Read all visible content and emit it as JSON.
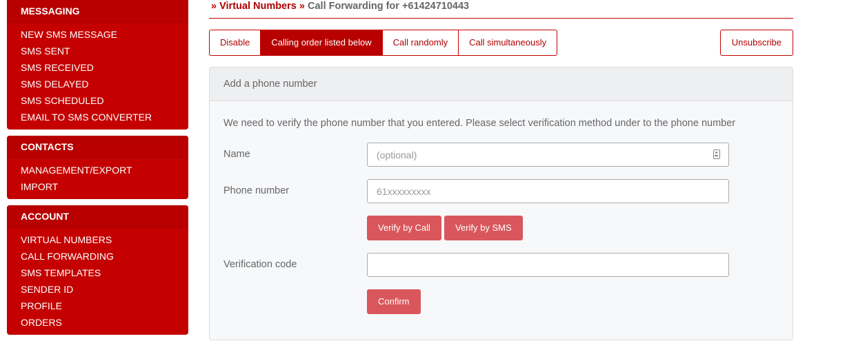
{
  "sidebar": {
    "messaging": {
      "title": "MESSAGING",
      "items": [
        "NEW SMS MESSAGE",
        "SMS SENT",
        "SMS RECEIVED",
        "SMS DELAYED",
        "SMS SCHEDULED",
        "EMAIL TO SMS CONVERTER"
      ]
    },
    "contacts": {
      "title": "CONTACTS",
      "items": [
        "MANAGEMENT/EXPORT",
        "IMPORT"
      ]
    },
    "account": {
      "title": "ACCOUNT",
      "items": [
        "VIRTUAL NUMBERS",
        "CALL FORWARDING",
        "SMS TEMPLATES",
        "SENDER ID",
        "PROFILE",
        "ORDERS"
      ]
    }
  },
  "breadcrumb": {
    "sep1": "»",
    "link": "Virtual Numbers",
    "sep2": "»",
    "current": "Call Forwarding for +61424710443"
  },
  "toolbar": {
    "buttons": [
      "Disable",
      "Calling order listed below",
      "Call randomly",
      "Call simultaneously"
    ],
    "active_index": 1,
    "unsubscribe": "Unsubscribe"
  },
  "card": {
    "title": "Add a phone number",
    "note": "We need to verify the phone number that you entered. Please select verification method under to the phone number",
    "name_label": "Name",
    "name_placeholder": "(optional)",
    "phone_label": "Phone number",
    "phone_placeholder": "61xxxxxxxxx",
    "verify_call": "Verify by Call",
    "verify_sms": "Verify by SMS",
    "code_label": "Verification code",
    "code_value": "",
    "confirm": "Confirm"
  },
  "colors": {
    "brand": "#c40000",
    "button": "#d9575c"
  }
}
